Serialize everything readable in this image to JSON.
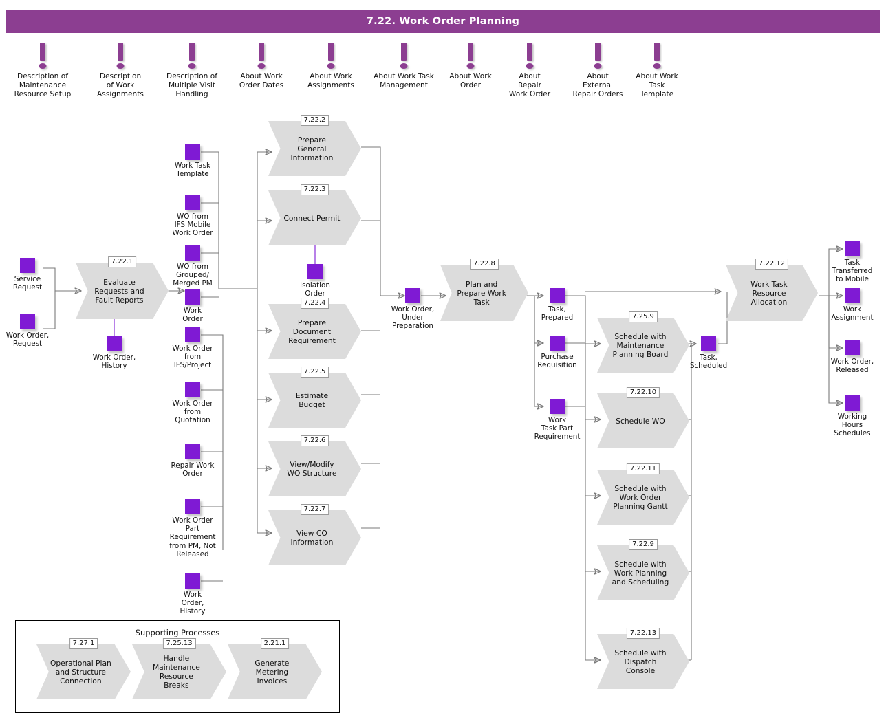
{
  "header": {
    "title": "7.22. Work Order Planning",
    "bar_color": "#8c3e91"
  },
  "colors": {
    "accent_purple": "#7f1ad4",
    "header_purple": "#8c3e91",
    "process_gray": "#dcdcdc",
    "line_gray": "#7a7a7a"
  },
  "info_icons": [
    {
      "icon": "exclamation-icon",
      "label": "Description of\nMaintenance\nResource Setup"
    },
    {
      "icon": "exclamation-icon",
      "label": "Description\nof Work\nAssignments"
    },
    {
      "icon": "exclamation-icon",
      "label": "Description of\nMultiple Visit\nHandling"
    },
    {
      "icon": "exclamation-icon",
      "label": "About Work\nOrder Dates"
    },
    {
      "icon": "exclamation-icon",
      "label": "About Work\nAssignments"
    },
    {
      "icon": "exclamation-icon",
      "label": "About Work Task\nManagement"
    },
    {
      "icon": "exclamation-icon",
      "label": "About Work\nOrder"
    },
    {
      "icon": "exclamation-icon",
      "label": "About\nRepair\nWork Order"
    },
    {
      "icon": "exclamation-icon",
      "label": "About\nExternal\nRepair Orders"
    },
    {
      "icon": "exclamation-icon",
      "label": "About Work\nTask\nTemplate"
    }
  ],
  "objects": {
    "service_request": "Service\nRequest",
    "work_order_request": "Work Order,\nRequest",
    "work_order_history_in": "Work Order,\nHistory",
    "work_task_template": "Work Task\nTemplate",
    "wo_from_ifs_mobile": "WO from\nIFS Mobile\nWork Order",
    "wo_from_grouped_merged_pm": "WO from\nGrouped/\nMerged PM",
    "work_order": "Work\nOrder",
    "wo_from_ifs_project": "Work Order\nfrom\nIFS/Project",
    "wo_from_quotation": "Work Order\nfrom\nQuotation",
    "repair_work_order": "Repair Work\nOrder",
    "wo_part_req_from_pm": "Work Order\nPart\nRequirement\nfrom PM, Not\nReleased",
    "work_order_history_bottom": "Work\nOrder,\nHistory",
    "isolation_order": "Isolation\nOrder",
    "work_order_under_preparation": "Work Order,\nUnder\nPreparation",
    "task_prepared": "Task,\nPrepared",
    "purchase_requisition": "Purchase\nRequisition",
    "work_task_part_requirement": "Work\nTask Part\nRequirement",
    "task_scheduled": "Task,\nScheduled",
    "task_transferred_to_mobile": "Task\nTransferred\nto Mobile",
    "work_assignment": "Work\nAssignment",
    "work_order_released": "Work Order,\nReleased",
    "working_hours_schedules": "Working\nHours\nSchedules"
  },
  "processes": {
    "p_evaluate": {
      "id": "7.22.1",
      "label": "Evaluate\nRequests and\nFault Reports"
    },
    "p_prepare_general": {
      "id": "7.22.2",
      "label": "Prepare\nGeneral\nInformation"
    },
    "p_connect_permit": {
      "id": "7.22.3",
      "label": "Connect Permit"
    },
    "p_prepare_doc": {
      "id": "7.22.4",
      "label": "Prepare\nDocument\nRequirement"
    },
    "p_estimate_budget": {
      "id": "7.22.5",
      "label": "Estimate\nBudget"
    },
    "p_view_modify_wo": {
      "id": "7.22.6",
      "label": "View/Modify\nWO Structure"
    },
    "p_view_co": {
      "id": "7.22.7",
      "label": "View CO\nInformation"
    },
    "p_plan_prepare": {
      "id": "7.22.8",
      "label": "Plan and\nPrepare Work\nTask"
    },
    "p_sched_mpb": {
      "id": "7.25.9",
      "label": "Schedule with\nMaintenance\nPlanning Board"
    },
    "p_sched_wo": {
      "id": "7.22.10",
      "label": "Schedule WO"
    },
    "p_sched_gantt": {
      "id": "7.22.11",
      "label": "Schedule with\nWork Order\nPlanning Gantt"
    },
    "p_sched_wps": {
      "id": "7.22.9",
      "label": "Schedule with\nWork Planning\nand Scheduling"
    },
    "p_sched_dispatch": {
      "id": "7.22.13",
      "label": "Schedule with\nDispatch\nConsole"
    },
    "p_wt_resource_alloc": {
      "id": "7.22.12",
      "label": "Work Task\nResource\nAllocation"
    }
  },
  "supporting": {
    "title": "Supporting Processes",
    "items": [
      {
        "id": "7.27.1",
        "label": "Operational Plan\nand Structure\nConnection"
      },
      {
        "id": "7.25.13",
        "label": "Handle\nMaintenance\nResource\nBreaks"
      },
      {
        "id": "2.21.1",
        "label": "Generate\nMetering\nInvoices"
      }
    ]
  }
}
